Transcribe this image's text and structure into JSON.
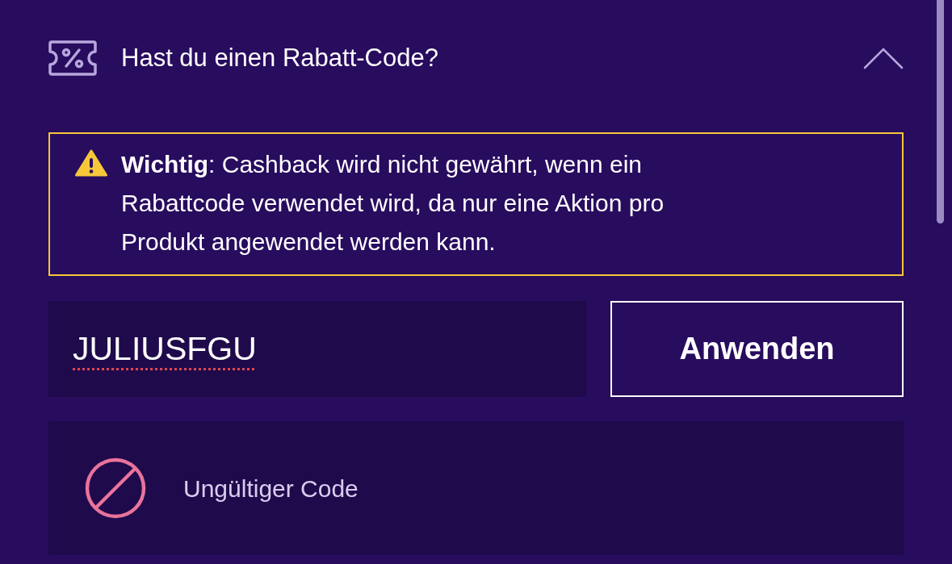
{
  "discount": {
    "title": "Hast du einen Rabatt-Code?",
    "expanded": true,
    "notice": {
      "kind": "warning",
      "text": "**Wichtig**: Cashback wird nicht gewährt, wenn ein Rabattcode verwendet wird, da nur eine Aktion pro Produkt angewendet werden kann."
    },
    "code_field": {
      "value": "JULIUSFGU",
      "spelling_error": true
    },
    "apply_button": {
      "label": "Anwenden"
    },
    "message": {
      "kind": "error",
      "text": "Ungültiger Code"
    }
  }
}
